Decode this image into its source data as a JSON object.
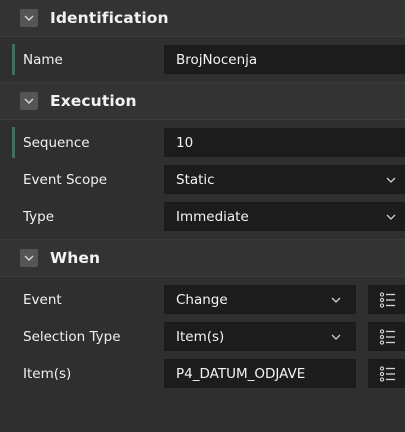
{
  "sections": {
    "identification": {
      "title": "Identification",
      "fields": {
        "name": {
          "label": "Name",
          "value": "BrojNocenja"
        }
      }
    },
    "execution": {
      "title": "Execution",
      "fields": {
        "sequence": {
          "label": "Sequence",
          "value": "10"
        },
        "event_scope": {
          "label": "Event Scope",
          "value": "Static"
        },
        "type": {
          "label": "Type",
          "value": "Immediate"
        }
      }
    },
    "when": {
      "title": "When",
      "fields": {
        "event": {
          "label": "Event",
          "value": "Change"
        },
        "selection_type": {
          "label": "Selection Type",
          "value": "Item(s)"
        },
        "items": {
          "label": "Item(s)",
          "value": "P4_DATUM_ODJAVE"
        }
      }
    }
  },
  "icons": {
    "collapse": "chevron-down-icon",
    "dropdown": "caret-down-icon",
    "list": "list-icon"
  },
  "colors": {
    "panel_bg": "#2f2f2f",
    "field_bg": "#1c1c1c",
    "active_marker": "#3f6e5f",
    "text": "#f0f0f0"
  }
}
